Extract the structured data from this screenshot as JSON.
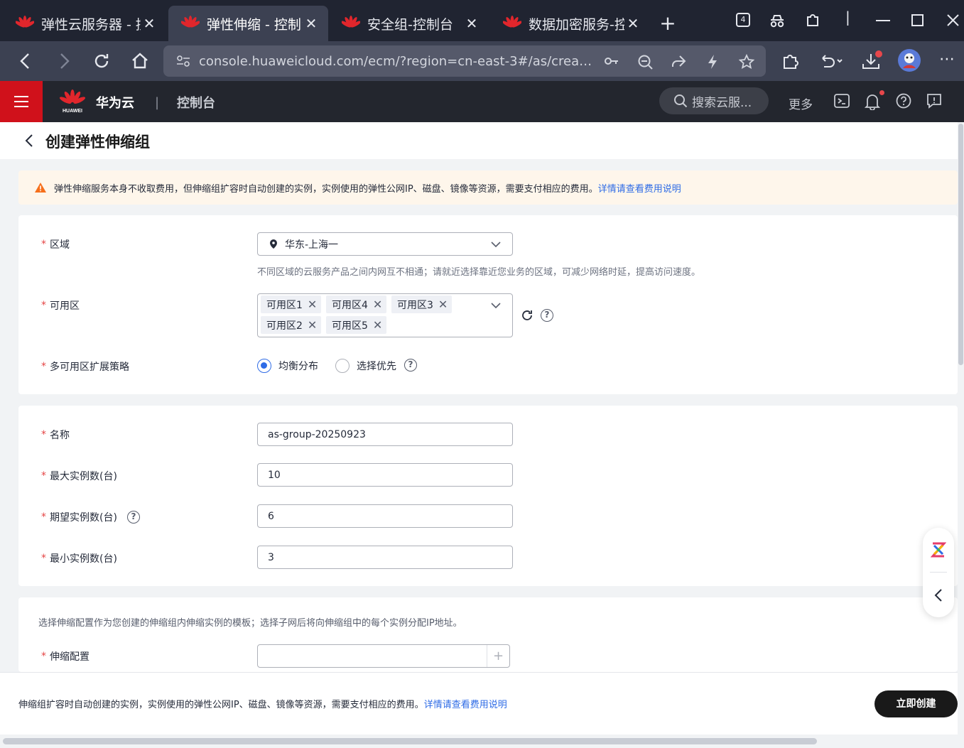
{
  "browser": {
    "tabs": [
      {
        "title": "弹性云服务器 - 控",
        "close": "✕"
      },
      {
        "title": "弹性伸缩 - 控制台",
        "close": "✕"
      },
      {
        "title": "安全组-控制台",
        "close": "✕"
      },
      {
        "title": "数据加密服务-控",
        "close": "✕"
      }
    ],
    "new_tab": "+",
    "tab_count": "4",
    "url": "console.huaweicloud.com/ecm/?region=cn-east-3#/as/create..."
  },
  "header": {
    "brand": "华为云",
    "separator": "|",
    "console": "控制台",
    "logo_text": "HUAWEI",
    "search_placeholder": "搜索云服...",
    "more": "更多"
  },
  "page": {
    "title": "创建弹性伸缩组"
  },
  "notice": {
    "text": "弹性伸缩服务本身不收取费用，但伸缩组扩容时自动创建的实例，实例使用的弹性公网IP、磁盘、镜像等资源，需要支付相应的费用。",
    "link": "详情请查看费用说明"
  },
  "region_section": {
    "region_label": "区域",
    "region_value": "华东-上海一",
    "region_hint": "不同区域的云服务产品之间内网互不相通；请就近选择靠近您业务的区域，可减少网络时延，提高访问速度。",
    "az_label": "可用区",
    "az_tags": [
      "可用区1",
      "可用区4",
      "可用区3",
      "可用区2",
      "可用区5"
    ],
    "strategy_label": "多可用区扩展策略",
    "strategy_options": [
      "均衡分布",
      "选择优先"
    ],
    "strategy_selected": "均衡分布"
  },
  "basic_section": {
    "name_label": "名称",
    "name_value": "as-group-20250923",
    "max_label": "最大实例数(台)",
    "max_value": "10",
    "desired_label": "期望实例数(台)",
    "desired_value": "6",
    "min_label": "最小实例数(台)",
    "min_value": "3"
  },
  "config_section": {
    "description": "选择伸缩配置作为您创建的伸缩组内伸缩实例的模板；选择子网后将向伸缩组中的每个实例分配IP地址。",
    "config_label": "伸缩配置",
    "config_value": "",
    "add": "+"
  },
  "footer": {
    "text": "伸缩组扩容时自动创建的实例，实例使用的弹性公网IP、磁盘、镜像等资源，需要支付相应的费用。",
    "link": "详情请查看费用说明",
    "create_button": "立即创建"
  },
  "symbols": {
    "required": "*",
    "help": "?"
  },
  "colors": {
    "brand_red": "#d0111b",
    "link_blue": "#2e6be6",
    "header_bg": "#23262e",
    "notice_bg": "#fef6eb",
    "required_red": "#e54545"
  }
}
